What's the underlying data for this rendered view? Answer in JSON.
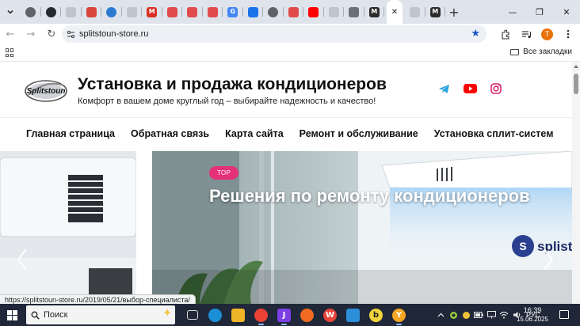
{
  "browser": {
    "tabs": [
      {
        "icon": "chrome-icon",
        "letter": "",
        "color": "#5f6368"
      },
      {
        "icon": "github-icon",
        "letter": "",
        "color": "#24292f"
      },
      {
        "icon": "blank-page-icon",
        "letter": "",
        "color": "#c0c4cc"
      },
      {
        "icon": "bug-icon",
        "letter": "",
        "color": "#d9443b"
      },
      {
        "icon": "refresh-site-icon",
        "letter": "",
        "color": "#2d7bd1"
      },
      {
        "icon": "blank-page-icon",
        "letter": "",
        "color": "#c0c4cc"
      },
      {
        "icon": "gmail-icon",
        "letter": "M",
        "color": "#d93025"
      },
      {
        "icon": "red-app-icon",
        "letter": "",
        "color": "#e24b4b"
      },
      {
        "icon": "red-app-icon",
        "letter": "",
        "color": "#e24b4b"
      },
      {
        "icon": "red-app-icon",
        "letter": "",
        "color": "#e24b4b"
      },
      {
        "icon": "google-icon",
        "letter": "G",
        "color": "#4285f4"
      },
      {
        "icon": "download-icon",
        "letter": "",
        "color": "#1a73e8"
      },
      {
        "icon": "globe-icon",
        "letter": "",
        "color": "#5f6368"
      },
      {
        "icon": "red-app-icon",
        "letter": "",
        "color": "#e24b4b"
      },
      {
        "icon": "youtube-icon",
        "letter": "",
        "color": "#ff0000"
      },
      {
        "icon": "blank-page-icon",
        "letter": "",
        "color": "#c0c4cc"
      },
      {
        "icon": "shop-icon",
        "letter": "",
        "color": "#6b6f78"
      },
      {
        "icon": "marker-icon",
        "letter": "M",
        "color": "#2b2b2b"
      }
    ],
    "active_tab_close": "✕",
    "tabs_after": [
      {
        "icon": "blank-page-icon",
        "letter": "",
        "color": "#c0c4cc"
      },
      {
        "icon": "marker-icon",
        "letter": "M",
        "color": "#2b2b2b"
      }
    ],
    "new_tab": "+",
    "window_controls": {
      "minimize": "—",
      "maximize": "❐",
      "close": "✕"
    },
    "toolbar": {
      "back": "←",
      "forward": "→",
      "reload": "↻",
      "url": "splitstoun-store.ru",
      "profile_letter": "T"
    },
    "bookmarks": {
      "all_bookmarks": "Все закладки"
    }
  },
  "site": {
    "title": "Установка и продажа кондиционеров",
    "tagline": "Комфорт в вашем доме круглый год – выбирайте надежность и качество!",
    "logo_text": "Splitstoun",
    "nav": [
      "Главная страница",
      "Обратная связь",
      "Карта сайта",
      "Ремонт и обслуживание",
      "Установка сплит-систем"
    ],
    "slide": {
      "badge": "TOP",
      "title": "Решения по ремонту кондиционеров",
      "brand_partial": "splist"
    },
    "social_colors": {
      "telegram": "#2aa3dd",
      "youtube": "#ff0000",
      "instagram": "#d6246f"
    }
  },
  "status_url": "https://splitstoun-store.ru/2019/05/21/выбор-специалиста/",
  "taskbar": {
    "search_placeholder": "Поиск",
    "apps": [
      {
        "name": "task-view",
        "letter": "",
        "color": "#1f2738"
      },
      {
        "name": "edge",
        "letter": "",
        "color": "#1a8fd8"
      },
      {
        "name": "file-explorer",
        "letter": "",
        "color": "#f0b429"
      },
      {
        "name": "chrome",
        "letter": "",
        "color": "#ea4335"
      },
      {
        "name": "jetbrains",
        "letter": "J",
        "color": "#7b3fe4"
      },
      {
        "name": "sketch",
        "letter": "",
        "color": "#f26b21"
      },
      {
        "name": "wps",
        "letter": "W",
        "color": "#e8443a"
      },
      {
        "name": "vscode",
        "letter": "",
        "color": "#2c8dd8"
      },
      {
        "name": "b-app",
        "letter": "b",
        "color": "#f1d33a"
      },
      {
        "name": "yandex-browser",
        "letter": "Y",
        "color": "#f5a623"
      }
    ],
    "language": "РУС",
    "time": "16:39",
    "date": "15.06.2025"
  }
}
